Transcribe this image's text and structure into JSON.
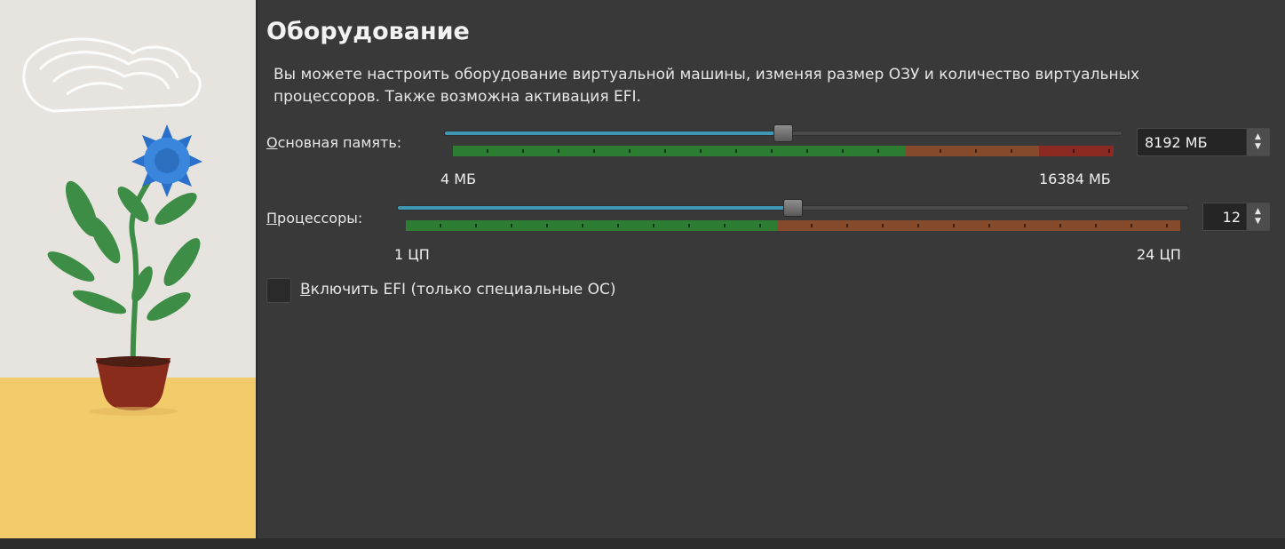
{
  "page": {
    "title": "Оборудование",
    "description": "Вы можете настроить оборудование виртуальной машины, изменяя размер ОЗУ и количество виртуальных процессоров. Также возможна активация EFI."
  },
  "memory": {
    "label_mnemonic": "О",
    "label_rest": "сновная память:",
    "min_label": "4 МБ",
    "max_label": "16384 МБ",
    "value": "8192 МБ",
    "level": 0.5
  },
  "processors": {
    "label_mnemonic": "П",
    "label_rest": "роцессоры:",
    "min_label": "1 ЦП",
    "max_label": "24 ЦП",
    "value": "12",
    "level": 0.5
  },
  "efi": {
    "label_mnemonic": "В",
    "label_rest": "ключить EFI (только специальные ОС)",
    "checked": false
  },
  "icons": {
    "spin_up": "spin-up-arrow-icon",
    "spin_down": "spin-down-arrow-icon",
    "illustration": "potted-flower-illustration"
  },
  "colors": {
    "slider_fill": "#3f98b3",
    "scale_green": "#2c7c32",
    "scale_orange": "#854a2c",
    "scale_red": "#8a2a22"
  }
}
